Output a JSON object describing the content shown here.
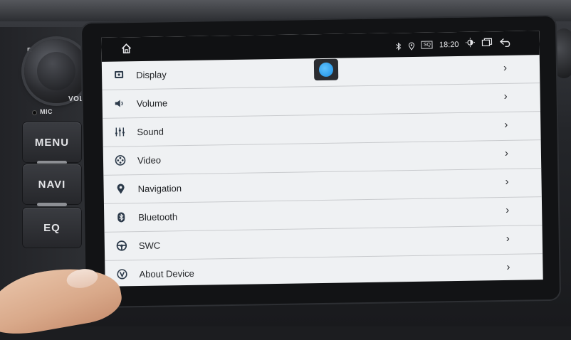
{
  "hardware": {
    "vol_label": "VOL",
    "mic_label": "MIC",
    "r_label": "R",
    "buttons": [
      {
        "label": "MENU"
      },
      {
        "label": "NAVI"
      },
      {
        "label": "EQ"
      }
    ]
  },
  "status_bar": {
    "time": "18:20",
    "badge": "SQ"
  },
  "menu": [
    {
      "label": "Display",
      "icon": "display-icon"
    },
    {
      "label": "Volume",
      "icon": "speaker-icon"
    },
    {
      "label": "Sound",
      "icon": "equalizer-icon"
    },
    {
      "label": "Video",
      "icon": "film-reel-icon"
    },
    {
      "label": "Navigation",
      "icon": "map-pin-icon"
    },
    {
      "label": "Bluetooth",
      "icon": "bluetooth-icon"
    },
    {
      "label": "SWC",
      "icon": "steering-wheel-icon"
    },
    {
      "label": "About Device",
      "icon": "info-v-icon"
    }
  ],
  "chevron": "›",
  "colors": {
    "screen_bg": "#eff1f3",
    "status_bg": "#101113",
    "accent_touch": "#1d8fe2"
  }
}
